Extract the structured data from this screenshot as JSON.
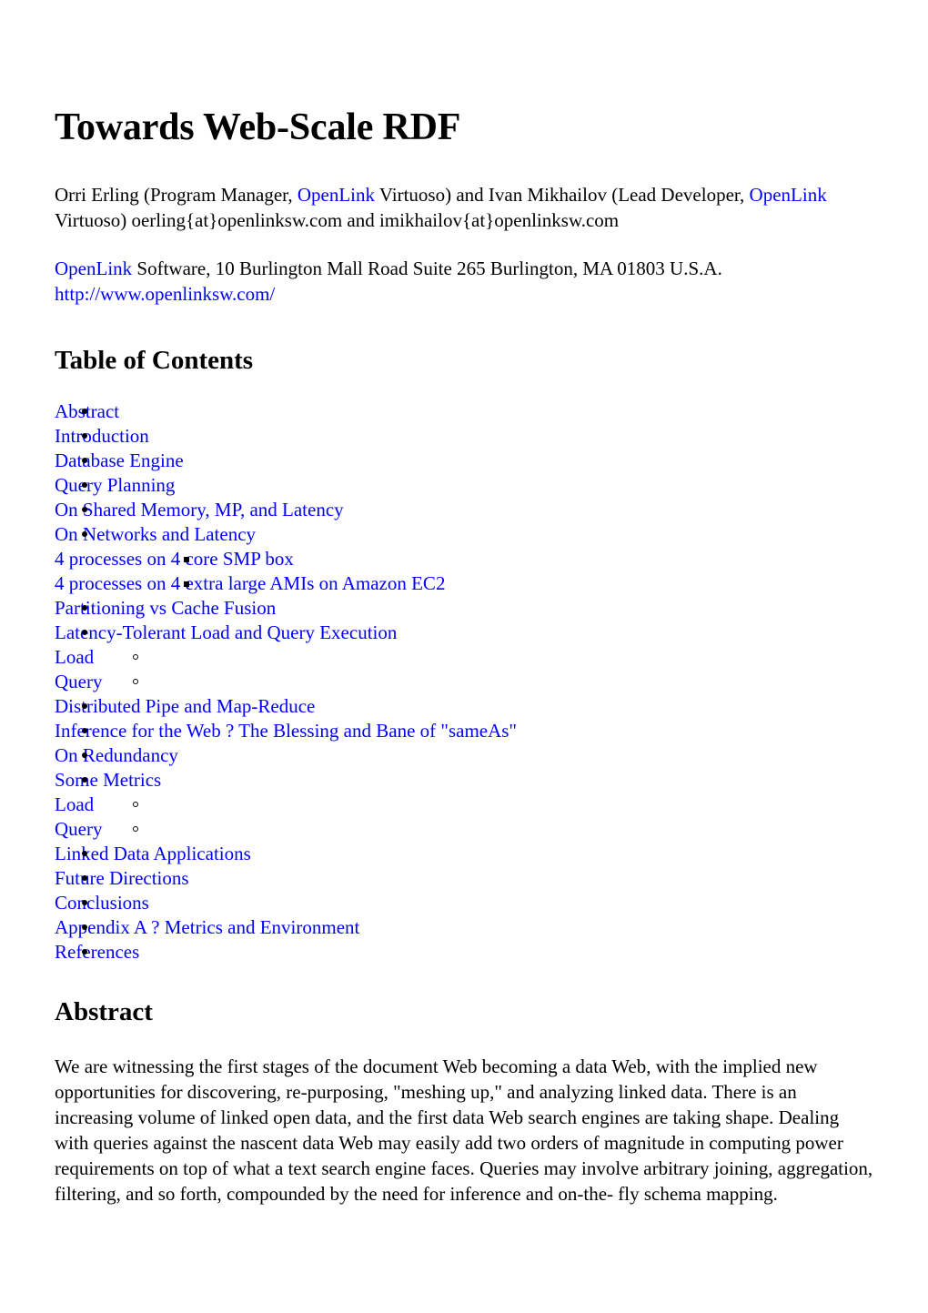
{
  "document": {
    "title": "Towards Web-Scale RDF",
    "authors_line_1_part_1": "Orri Erling (Program Manager, ",
    "authors_openlink_1": "OpenLink",
    "authors_line_1_part_2": " Virtuoso) and Ivan Mikhailov (Lead Developer,",
    "authors_openlink_2": "OpenLink",
    "authors_line_2_part_2": " Virtuoso) oerling{at}openlinksw.com and imikhailov{at}openlinksw.com",
    "address_openlink": "OpenLink",
    "address_text": " Software, 10 Burlington Mall Road Suite 265 Burlington, MA 01803 U.S.A.",
    "address_url": "http://www.openlinksw.com/"
  },
  "toc": {
    "heading": "Table of Contents",
    "items": [
      {
        "label": "Abstract",
        "level": 1
      },
      {
        "label": "Introduction",
        "level": 1
      },
      {
        "label": "Database Engine",
        "level": 1
      },
      {
        "label": "Query Planning",
        "level": 1
      },
      {
        "label": "On Shared Memory, MP, and Latency",
        "level": 1
      },
      {
        "label": "On Networks and Latency",
        "level": 1
      },
      {
        "label": "4 processes on 4 core SMP box",
        "level": 3
      },
      {
        "label": "4 processes on 4 extra large AMIs on Amazon EC2",
        "level": 3
      },
      {
        "label": "Partitioning vs Cache Fusion",
        "level": 1
      },
      {
        "label": "Latency-Tolerant Load and Query Execution",
        "level": 1
      },
      {
        "label": "Load",
        "level": 2
      },
      {
        "label": "Query",
        "level": 2
      },
      {
        "label": "Distributed Pipe and Map-Reduce",
        "level": 1
      },
      {
        "label": "Inference for the Web ? The Blessing and Bane of \"sameAs\"",
        "level": 1
      },
      {
        "label": "On Redundancy",
        "level": 1
      },
      {
        "label": "Some Metrics",
        "level": 1
      },
      {
        "label": "Load",
        "level": 2
      },
      {
        "label": "Query",
        "level": 2
      },
      {
        "label": "Linked Data Applications",
        "level": 1
      },
      {
        "label": "Future Directions",
        "level": 1
      },
      {
        "label": "Conclusions",
        "level": 1
      },
      {
        "label": "Appendix A ? Metrics and Environment",
        "level": 1
      },
      {
        "label": "References",
        "level": 1
      }
    ]
  },
  "abstract": {
    "heading": "Abstract",
    "body": "We are witnessing the first stages of the document Web becoming a data Web, with the implied new opportunities for discovering, re-purposing, \"meshing up,\" and analyzing linked data. There is an increasing volume of linked open data, and the first data Web search engines are taking shape. Dealing with queries against the nascent data Web may easily add two orders of magnitude in computing power requirements on top of what a text search engine faces. Queries may involve arbitrary joining, aggregation, filtering, and so forth, compounded by the need for inference and on-the- fly schema mapping."
  },
  "colors": {
    "link": "#0000ff",
    "text": "#000000",
    "background": "#ffffff"
  }
}
